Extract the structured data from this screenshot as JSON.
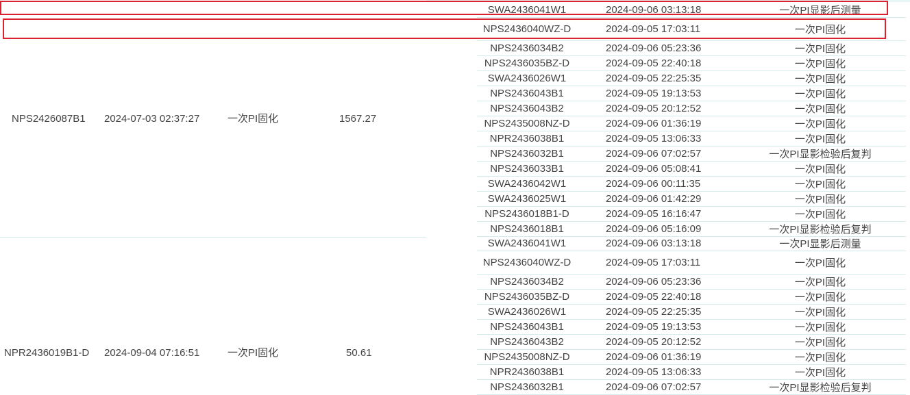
{
  "left_rows": [
    {
      "id": "NPS2426087B1",
      "time": "2024-07-03 02:37:27",
      "process": "一次PI固化",
      "value": "1567.27"
    },
    {
      "id": "NPR2436019B1-D",
      "time": "2024-09-04 07:16:51",
      "process": "一次PI固化",
      "value": "50.61"
    }
  ],
  "right_rows": [
    {
      "id": "SWA2436041W1",
      "time": "2024-09-06 03:13:18",
      "process": "一次PI显影后测量"
    },
    {
      "id": "NPS2436040WZ-D",
      "time": "2024-09-05 17:03:11",
      "process": "一次PI固化"
    },
    {
      "id": "NPS2436034B2",
      "time": "2024-09-06 05:23:36",
      "process": "一次PI固化"
    },
    {
      "id": "NPS2436035BZ-D",
      "time": "2024-09-05 22:40:18",
      "process": "一次PI固化"
    },
    {
      "id": "SWA2436026W1",
      "time": "2024-09-05 22:25:35",
      "process": "一次PI固化"
    },
    {
      "id": "NPS2436043B1",
      "time": "2024-09-05 19:13:53",
      "process": "一次PI固化"
    },
    {
      "id": "NPS2436043B2",
      "time": "2024-09-05 20:12:52",
      "process": "一次PI固化"
    },
    {
      "id": "NPS2435008NZ-D",
      "time": "2024-09-06 01:36:19",
      "process": "一次PI固化"
    },
    {
      "id": "NPR2436038B1",
      "time": "2024-09-05 13:06:33",
      "process": "一次PI固化"
    },
    {
      "id": "NPS2436032B1",
      "time": "2024-09-06 07:02:57",
      "process": "一次PI显影检验后复判"
    },
    {
      "id": "NPS2436033B1",
      "time": "2024-09-06 05:08:41",
      "process": "一次PI固化"
    },
    {
      "id": "SWA2436042W1",
      "time": "2024-09-06 00:11:35",
      "process": "一次PI固化"
    },
    {
      "id": "SWA2436025W1",
      "time": "2024-09-06 01:42:29",
      "process": "一次PI固化"
    },
    {
      "id": "NPS2436018B1-D",
      "time": "2024-09-05 16:16:47",
      "process": "一次PI固化"
    },
    {
      "id": "NPS2436018B1",
      "time": "2024-09-06 05:16:09",
      "process": "一次PI显影检验后复判"
    },
    {
      "id": "SWA2436041W1",
      "time": "2024-09-06 03:13:18",
      "process": "一次PI显影后测量"
    },
    {
      "id": "NPS2436040WZ-D",
      "time": "2024-09-05 17:03:11",
      "process": "一次PI固化"
    },
    {
      "id": "NPS2436034B2",
      "time": "2024-09-06 05:23:36",
      "process": "一次PI固化"
    },
    {
      "id": "NPS2436035BZ-D",
      "time": "2024-09-05 22:40:18",
      "process": "一次PI固化"
    },
    {
      "id": "SWA2436026W1",
      "time": "2024-09-05 22:25:35",
      "process": "一次PI固化"
    },
    {
      "id": "NPS2436043B1",
      "time": "2024-09-05 19:13:53",
      "process": "一次PI固化"
    },
    {
      "id": "NPS2436043B2",
      "time": "2024-09-05 20:12:52",
      "process": "一次PI固化"
    },
    {
      "id": "NPS2435008NZ-D",
      "time": "2024-09-06 01:36:19",
      "process": "一次PI固化"
    },
    {
      "id": "NPR2436038B1",
      "time": "2024-09-05 13:06:33",
      "process": "一次PI固化"
    },
    {
      "id": "NPS2436032B1",
      "time": "2024-09-06 07:02:57",
      "process": "一次PI显影检验后复判"
    }
  ],
  "colors": {
    "border": "#d6ecec",
    "highlight": "#d9232e",
    "text": "#444444"
  }
}
